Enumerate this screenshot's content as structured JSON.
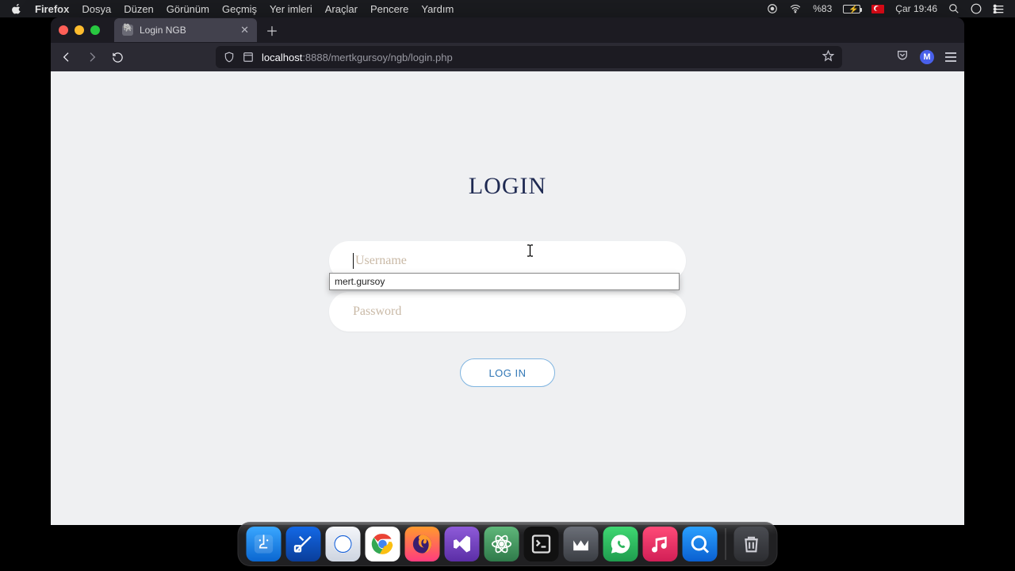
{
  "menubar": {
    "app_name": "Firefox",
    "items": [
      "Dosya",
      "Düzen",
      "Görünüm",
      "Geçmiş",
      "Yer imleri",
      "Araçlar",
      "Pencere",
      "Yardım"
    ],
    "battery_pct": "%83",
    "clock": "Çar 19:46"
  },
  "browser": {
    "tab_title": "Login NGB",
    "url_host": "localhost",
    "url_port": ":8888",
    "url_path": "/mertkgursoy/ngb/login.php",
    "avatar_letter": "M"
  },
  "page": {
    "title": "LOGIN",
    "username_placeholder": "Username",
    "password_placeholder": "Password",
    "submit_label": "LOG IN",
    "autocomplete_suggestion": "mert.gursoy"
  },
  "dock": {
    "apps": [
      "finder",
      "xcode",
      "safari",
      "chrome",
      "firefox",
      "vs",
      "atom",
      "term",
      "mamp",
      "wa",
      "music",
      "qt"
    ],
    "trash": "trash"
  }
}
